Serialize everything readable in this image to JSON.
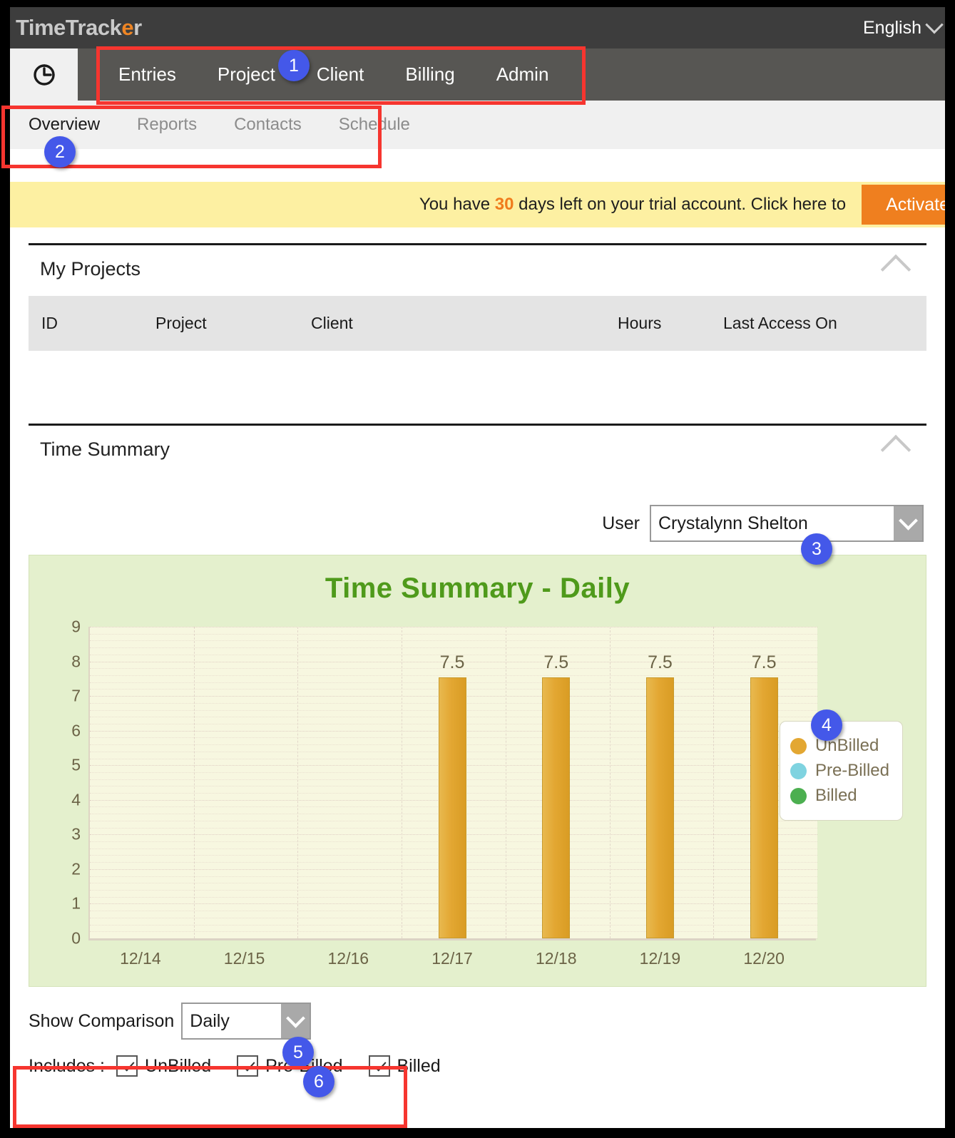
{
  "header": {
    "logo_main": "TimeTrack",
    "logo_accent": "e",
    "logo_tail": "r",
    "language": "English"
  },
  "nav": {
    "home_icon": "clock-icon",
    "items": [
      {
        "label": "Entries"
      },
      {
        "label": "Project"
      },
      {
        "label": "Client"
      },
      {
        "label": "Billing"
      },
      {
        "label": "Admin"
      }
    ]
  },
  "subnav": {
    "items": [
      {
        "label": "Overview",
        "active": true
      },
      {
        "label": "Reports",
        "active": false
      },
      {
        "label": "Contacts",
        "active": false
      },
      {
        "label": "Schedule",
        "active": false
      }
    ]
  },
  "banner": {
    "text_before": "You have ",
    "days": "30",
    "text_after": " days left on your trial account. Click here to",
    "button_label": "Activate"
  },
  "projects_panel": {
    "title": "My Projects",
    "collapse_icon": "chevron-up-icon",
    "columns": [
      "ID",
      "Project",
      "Client",
      "Hours",
      "Last Access On"
    ],
    "rows": []
  },
  "time_summary": {
    "title": "Time Summary",
    "collapse_icon": "chevron-up-icon",
    "user_label": "User",
    "user_value": "Crystalynn Shelton"
  },
  "controls": {
    "comparison_label": "Show Comparison",
    "comparison_value": "Daily",
    "includes_label": "Includes :",
    "checkboxes": [
      {
        "label": "UnBilled",
        "checked": true
      },
      {
        "label": "Pre-Billed",
        "checked": true
      },
      {
        "label": "Billed",
        "checked": true
      }
    ]
  },
  "annotations": [
    {
      "number": "1"
    },
    {
      "number": "2"
    },
    {
      "number": "3"
    },
    {
      "number": "4"
    },
    {
      "number": "5"
    },
    {
      "number": "6"
    }
  ],
  "chart_data": {
    "type": "bar",
    "title": "Time Summary - Daily",
    "categories": [
      "12/14",
      "12/15",
      "12/16",
      "12/17",
      "12/18",
      "12/19",
      "12/20"
    ],
    "series": [
      {
        "name": "UnBilled",
        "color": "#e3a732",
        "values": [
          0,
          0,
          0,
          7.5,
          7.5,
          7.5,
          7.5
        ]
      },
      {
        "name": "Pre-Billed",
        "color": "#7fd3e0",
        "values": [
          0,
          0,
          0,
          0,
          0,
          0,
          0
        ]
      },
      {
        "name": "Billed",
        "color": "#4caf50",
        "values": [
          0,
          0,
          0,
          0,
          0,
          0,
          0
        ]
      }
    ],
    "data_labels": [
      "",
      "",
      "",
      "7.5",
      "7.5",
      "7.5",
      "7.5"
    ],
    "yticks": [
      0,
      1,
      2,
      3,
      4,
      5,
      6,
      7,
      8,
      9
    ],
    "ylim": [
      0,
      9
    ],
    "xlabel": "",
    "ylabel": "",
    "grid": true,
    "legend": [
      {
        "label": "UnBilled",
        "color": "#e3a732"
      },
      {
        "label": "Pre-Billed",
        "color": "#7fd3e0"
      },
      {
        "label": "Billed",
        "color": "#4caf50"
      }
    ],
    "legend_position": "right",
    "plot_bg": "#f7f7e0",
    "chart_bg": "#e4f0cd",
    "title_color": "#4f9a1b"
  }
}
